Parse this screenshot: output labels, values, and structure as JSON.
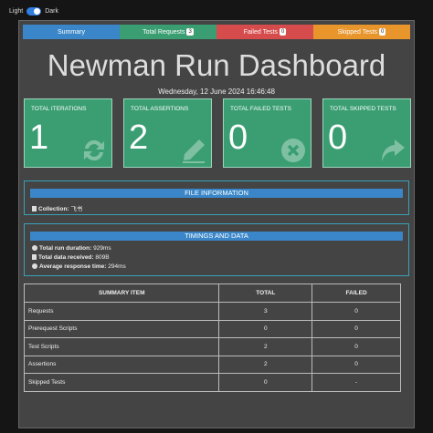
{
  "theme": {
    "light_label": "Light",
    "dark_label": "Dark"
  },
  "tabs": [
    {
      "label": "Summary",
      "badge": "",
      "color": "#3a86c8"
    },
    {
      "label": "Total Requests",
      "badge": "3",
      "color": "#3a9e72"
    },
    {
      "label": "Failed Tests",
      "badge": "0",
      "color": "#d64b4b"
    },
    {
      "label": "Skipped Tests",
      "badge": "0",
      "color": "#e8952b"
    }
  ],
  "title": "Newman Run Dashboard",
  "date": "Wednesday, 12 June 2024 16:46:48",
  "cards": [
    {
      "label": "TOTAL ITERATIONS",
      "value": "1",
      "icon": "sync-icon"
    },
    {
      "label": "TOTAL ASSERTIONS",
      "value": "2",
      "icon": "pencil-icon"
    },
    {
      "label": "TOTAL FAILED TESTS",
      "value": "0",
      "icon": "times-circle-icon"
    },
    {
      "label": "TOTAL SKIPPED TESTS",
      "value": "0",
      "icon": "share-arrow-icon"
    }
  ],
  "file_info": {
    "heading": "FILE INFORMATION",
    "collection_label": "Collection:",
    "collection_value": "飞书"
  },
  "timings": {
    "heading": "TIMINGS AND DATA",
    "duration_label": "Total run duration:",
    "duration_value": "929ms",
    "data_label": "Total data received:",
    "data_value": "809B",
    "response_label": "Average response time:",
    "response_value": "294ms"
  },
  "summary_table": {
    "headers": [
      "SUMMARY ITEM",
      "TOTAL",
      "FAILED"
    ],
    "rows": [
      [
        "Requests",
        "3",
        "0"
      ],
      [
        "Prerequest Scripts",
        "0",
        "0"
      ],
      [
        "Test Scripts",
        "2",
        "0"
      ],
      [
        "Assertions",
        "2",
        "0"
      ],
      [
        "Skipped Tests",
        "0",
        "-"
      ]
    ]
  }
}
